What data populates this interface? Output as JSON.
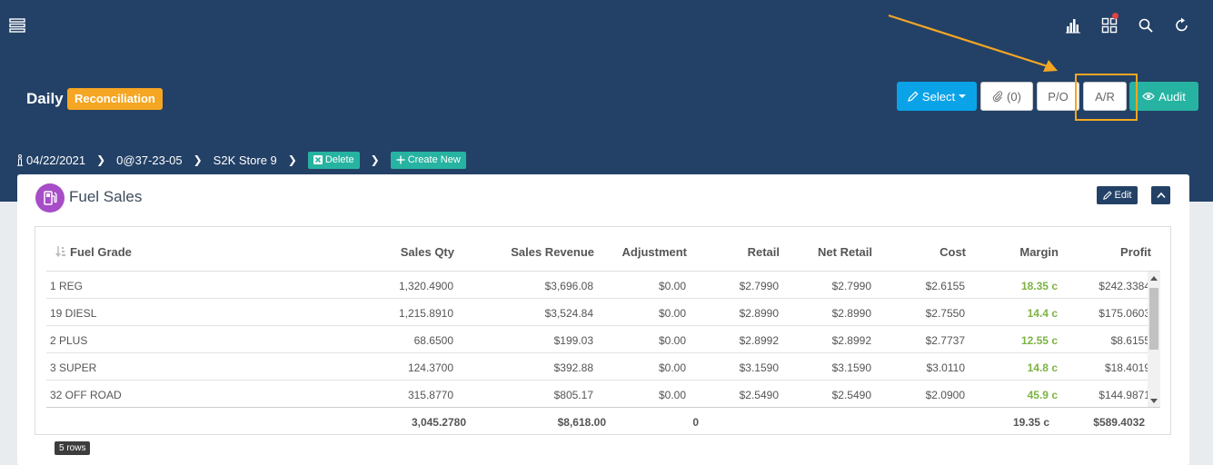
{
  "header": {
    "title": "Daily",
    "badge": "Reconciliation"
  },
  "toolbar": {
    "select_label": "Select",
    "attachments_label": "(0)",
    "po_label": "P/O",
    "ar_label": "A/R",
    "audit_label": "Audit"
  },
  "breadcrumb": {
    "date": "04/22/2021",
    "code": "0@37-23-05",
    "store": "S2K Store 9",
    "delete_label": "Delete",
    "create_label": "Create New"
  },
  "panel": {
    "title": "Fuel Sales",
    "edit_label": "Edit"
  },
  "table": {
    "columns": [
      "Fuel Grade",
      "Sales Qty",
      "Sales Revenue",
      "Adjustment",
      "Retail",
      "Net Retail",
      "Cost",
      "Margin",
      "Profit"
    ],
    "rows": [
      [
        "1 REG",
        "1,320.4900",
        "$3,696.08",
        "$0.00",
        "$2.7990",
        "$2.7990",
        "$2.6155",
        "18.35 c",
        "$242.3384"
      ],
      [
        "19 DIESL",
        "1,215.8910",
        "$3,524.84",
        "$0.00",
        "$2.8990",
        "$2.8990",
        "$2.7550",
        "14.4 c",
        "$175.0603"
      ],
      [
        "2 PLUS",
        "68.6500",
        "$199.03",
        "$0.00",
        "$2.8992",
        "$2.8992",
        "$2.7737",
        "12.55 c",
        "$8.6155"
      ],
      [
        "3 SUPER",
        "124.3700",
        "$392.88",
        "$0.00",
        "$3.1590",
        "$3.1590",
        "$3.0110",
        "14.8 c",
        "$18.4019"
      ],
      [
        "32 OFF ROAD",
        "315.8770",
        "$805.17",
        "$0.00",
        "$2.5490",
        "$2.5490",
        "$2.0900",
        "45.9 c",
        "$144.9871"
      ]
    ],
    "totals": {
      "sales_qty": "3,045.2780",
      "sales_revenue": "$8,618.00",
      "adjustment": "0",
      "margin": "19.35 c",
      "profit": "$589.4032"
    },
    "row_count": "5 rows"
  },
  "colors": {
    "header_bg": "#234166",
    "select_btn": "#0aa3e8",
    "audit_btn": "#27b3a1",
    "badge": "#f5a623",
    "margin_text": "#7cb342"
  }
}
